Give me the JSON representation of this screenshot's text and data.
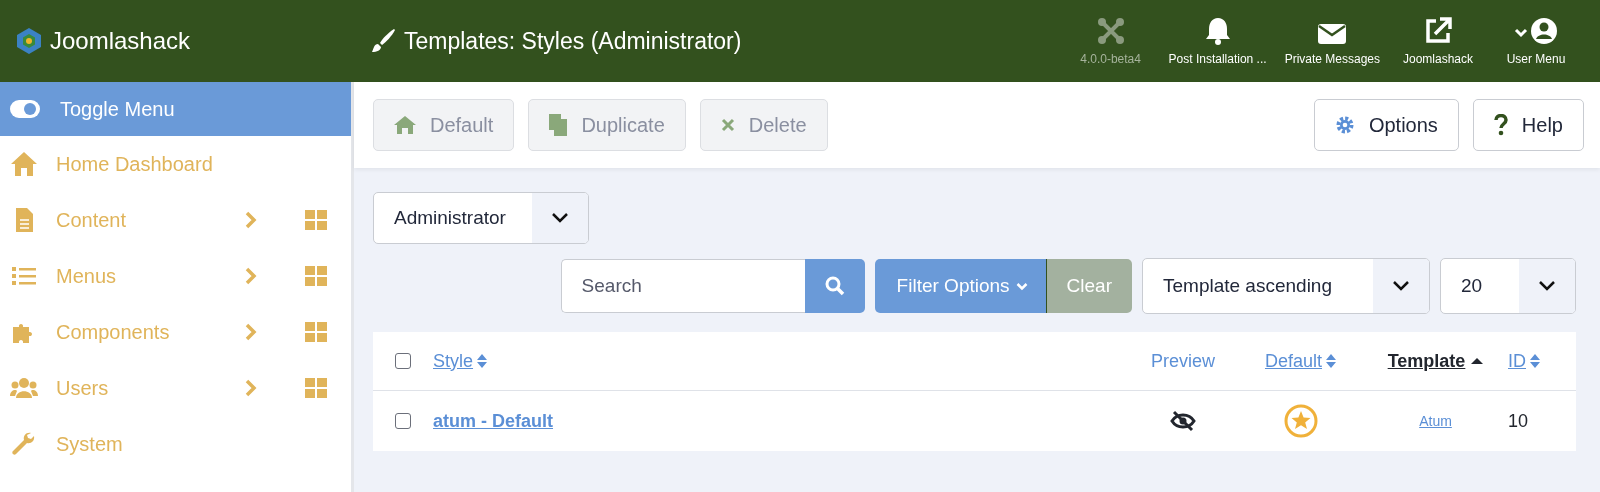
{
  "header": {
    "brand": "Joomlashack",
    "title": "Templates: Styles (Administrator)",
    "items": [
      {
        "kind": "joomla",
        "label": "4.0.0-beta4",
        "muted": true
      },
      {
        "kind": "bell",
        "label": "Post Installation ...",
        "muted": false
      },
      {
        "kind": "mail",
        "label": "Private Messages",
        "muted": false
      },
      {
        "kind": "external",
        "label": "Joomlashack",
        "muted": false
      },
      {
        "kind": "user",
        "label": "User Menu",
        "muted": false
      }
    ]
  },
  "sidebar": {
    "toggle": "Toggle Menu",
    "items": [
      {
        "kind": "home",
        "label": "Home Dashboard",
        "expandable": false
      },
      {
        "kind": "file",
        "label": "Content",
        "expandable": true
      },
      {
        "kind": "list",
        "label": "Menus",
        "expandable": true
      },
      {
        "kind": "puzzle",
        "label": "Components",
        "expandable": true
      },
      {
        "kind": "users",
        "label": "Users",
        "expandable": true
      },
      {
        "kind": "wrench",
        "label": "System",
        "expandable": false
      }
    ]
  },
  "toolbar": {
    "left": [
      {
        "kind": "home",
        "label": "Default",
        "disabled": true
      },
      {
        "kind": "copy",
        "label": "Duplicate",
        "disabled": true
      },
      {
        "kind": "x",
        "label": "Delete",
        "disabled": true
      }
    ],
    "right": [
      {
        "kind": "gear",
        "label": "Options",
        "disabled": false
      },
      {
        "kind": "question",
        "label": "Help",
        "disabled": false
      }
    ]
  },
  "filters": {
    "client": "Administrator",
    "search_placeholder": "Search",
    "filter_options": "Filter Options",
    "clear": "Clear",
    "ordering": "Template ascending",
    "limit": "20"
  },
  "table": {
    "select_all_checked": false,
    "columns": [
      {
        "label": "Style",
        "sortable": true,
        "active": false
      },
      {
        "label": "Preview",
        "sortable": false,
        "active": false
      },
      {
        "label": "Default",
        "sortable": true,
        "active": false
      },
      {
        "label": "Template",
        "sortable": true,
        "active": true
      },
      {
        "label": "ID",
        "sortable": true,
        "active": false
      }
    ],
    "rows": [
      {
        "checked": false,
        "style": "atum - Default",
        "preview": false,
        "default": true,
        "template": "Atum",
        "id": "10"
      }
    ]
  }
}
